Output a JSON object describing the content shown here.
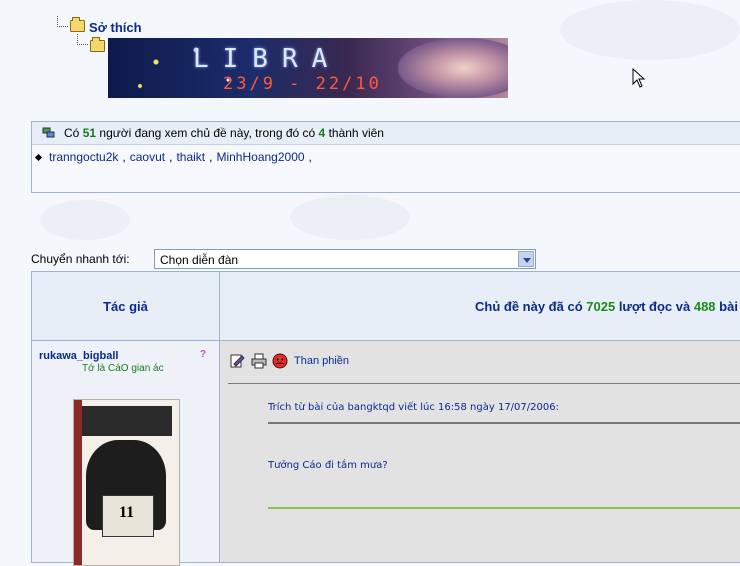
{
  "breadcrumb": {
    "label": "Sở thích"
  },
  "banner": {
    "title": "LIBRA",
    "date": "23/9 - 22/10"
  },
  "who_online": {
    "prefix": "Có",
    "count": "51",
    "middle": "người đang xem chủ đề này, trong đó có",
    "members": "4",
    "suffix": "thành viên",
    "users": [
      "tranngoctu2k",
      "caovut",
      "thaikt",
      "MinhHoang2000"
    ]
  },
  "jump": {
    "label": "Chuyển nhanh tới:",
    "selected": "Chọn diễn đàn"
  },
  "table": {
    "author_header": "Tác giả",
    "topic_prefix": "Chủ đề này đã có",
    "views": "7025",
    "views_mid": "lượt đọc và",
    "replies": "488",
    "replies_suffix": "bài"
  },
  "post": {
    "username": "rukawa_bigball",
    "user_title": "Tớ là CáO gian ác",
    "complain": "Than phiền",
    "quote_header": "Trích từ bài của bangktqd viết lúc 16:58 ngày 17/07/2006:",
    "quote_text": "Tưởng Cáo đi tắm mưa?",
    "avatar_number": "11"
  },
  "icons": [
    "folder-icon",
    "users-icon",
    "edit-icon",
    "print-icon",
    "complain-icon",
    "help-icon",
    "dropdown-arrow-icon",
    "cursor-icon"
  ],
  "colors": {
    "link": "#0b2a8f",
    "count_green": "#1a7b1a",
    "border": "#9fb3d1",
    "header_bg": "#e8eef7"
  }
}
